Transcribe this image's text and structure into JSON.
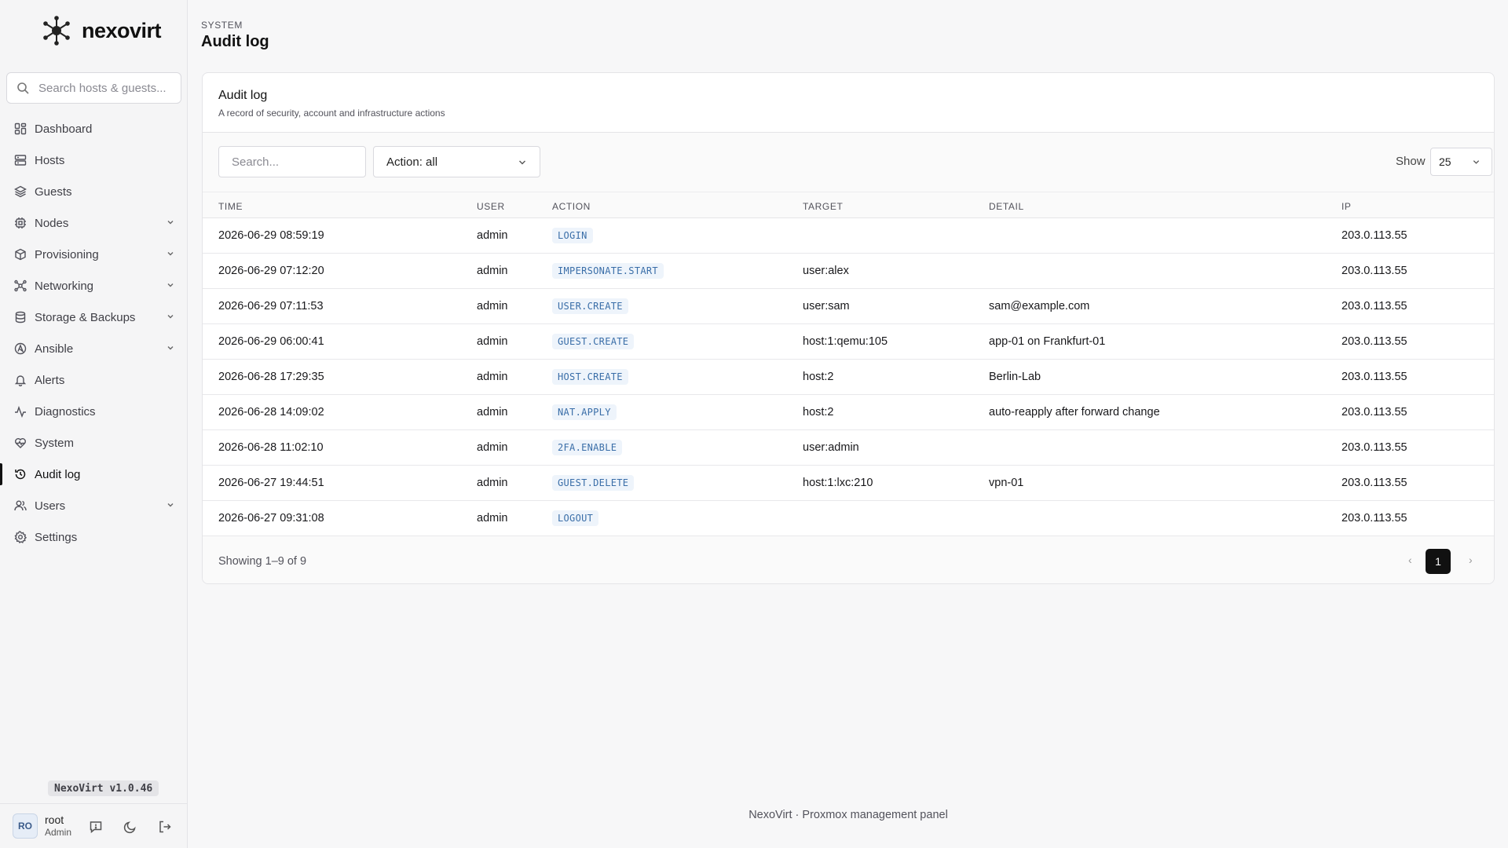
{
  "sidebar": {
    "brand": "nexovirt",
    "search_placeholder": "Search hosts & guests...",
    "items": [
      {
        "label": "Dashboard",
        "icon": "dashboard-icon"
      },
      {
        "label": "Hosts",
        "icon": "server-icon"
      },
      {
        "label": "Guests",
        "icon": "layers-icon"
      },
      {
        "label": "Nodes",
        "icon": "chip-icon",
        "expandable": true
      },
      {
        "label": "Provisioning",
        "icon": "package-icon",
        "expandable": true
      },
      {
        "label": "Networking",
        "icon": "network-icon",
        "expandable": true
      },
      {
        "label": "Storage & Backups",
        "icon": "database-icon",
        "expandable": true
      },
      {
        "label": "Ansible",
        "icon": "ansible-icon",
        "expandable": true
      },
      {
        "label": "Alerts",
        "icon": "bell-icon"
      },
      {
        "label": "Diagnostics",
        "icon": "activity-icon"
      },
      {
        "label": "System",
        "icon": "heart-pulse-icon"
      },
      {
        "label": "Audit log",
        "icon": "history-icon",
        "active": true
      },
      {
        "label": "Users",
        "icon": "users-icon",
        "expandable": true
      },
      {
        "label": "Settings",
        "icon": "gear-icon"
      }
    ],
    "version": "NexoVirt v1.0.46",
    "user": {
      "initials": "RO",
      "name": "root",
      "role": "Admin"
    }
  },
  "header": {
    "breadcrumb": "SYSTEM",
    "title": "Audit log"
  },
  "card": {
    "title": "Audit log",
    "subtitle": "A record of security, account and infrastructure actions",
    "search_placeholder": "Search...",
    "action_filter": "Action: all",
    "show_label": "Show",
    "show_value": "25",
    "columns": [
      "TIME",
      "USER",
      "ACTION",
      "TARGET",
      "DETAIL",
      "IP"
    ],
    "rows": [
      {
        "time": "2026-06-29 08:59:19",
        "user": "admin",
        "action": "LOGIN",
        "target": "",
        "detail": "",
        "ip": "203.0.113.55"
      },
      {
        "time": "2026-06-29 07:12:20",
        "user": "admin",
        "action": "IMPERSONATE.START",
        "target": "user:alex",
        "detail": "",
        "ip": "203.0.113.55"
      },
      {
        "time": "2026-06-29 07:11:53",
        "user": "admin",
        "action": "USER.CREATE",
        "target": "user:sam",
        "detail": "sam@example.com",
        "ip": "203.0.113.55"
      },
      {
        "time": "2026-06-29 06:00:41",
        "user": "admin",
        "action": "GUEST.CREATE",
        "target": "host:1:qemu:105",
        "detail": "app-01 on Frankfurt-01",
        "ip": "203.0.113.55"
      },
      {
        "time": "2026-06-28 17:29:35",
        "user": "admin",
        "action": "HOST.CREATE",
        "target": "host:2",
        "detail": "Berlin-Lab",
        "ip": "203.0.113.55"
      },
      {
        "time": "2026-06-28 14:09:02",
        "user": "admin",
        "action": "NAT.APPLY",
        "target": "host:2",
        "detail": "auto-reapply after forward change",
        "ip": "203.0.113.55"
      },
      {
        "time": "2026-06-28 11:02:10",
        "user": "admin",
        "action": "2FA.ENABLE",
        "target": "user:admin",
        "detail": "",
        "ip": "203.0.113.55"
      },
      {
        "time": "2026-06-27 19:44:51",
        "user": "admin",
        "action": "GUEST.DELETE",
        "target": "host:1:lxc:210",
        "detail": "vpn-01",
        "ip": "203.0.113.55"
      },
      {
        "time": "2026-06-27 09:31:08",
        "user": "admin",
        "action": "LOGOUT",
        "target": "",
        "detail": "",
        "ip": "203.0.113.55"
      }
    ],
    "showing": "Showing 1–9 of 9",
    "pagination": {
      "prev": "‹",
      "current": "1",
      "next": "›"
    }
  },
  "footer": {
    "text": "NexoVirt · Proxmox management panel"
  }
}
